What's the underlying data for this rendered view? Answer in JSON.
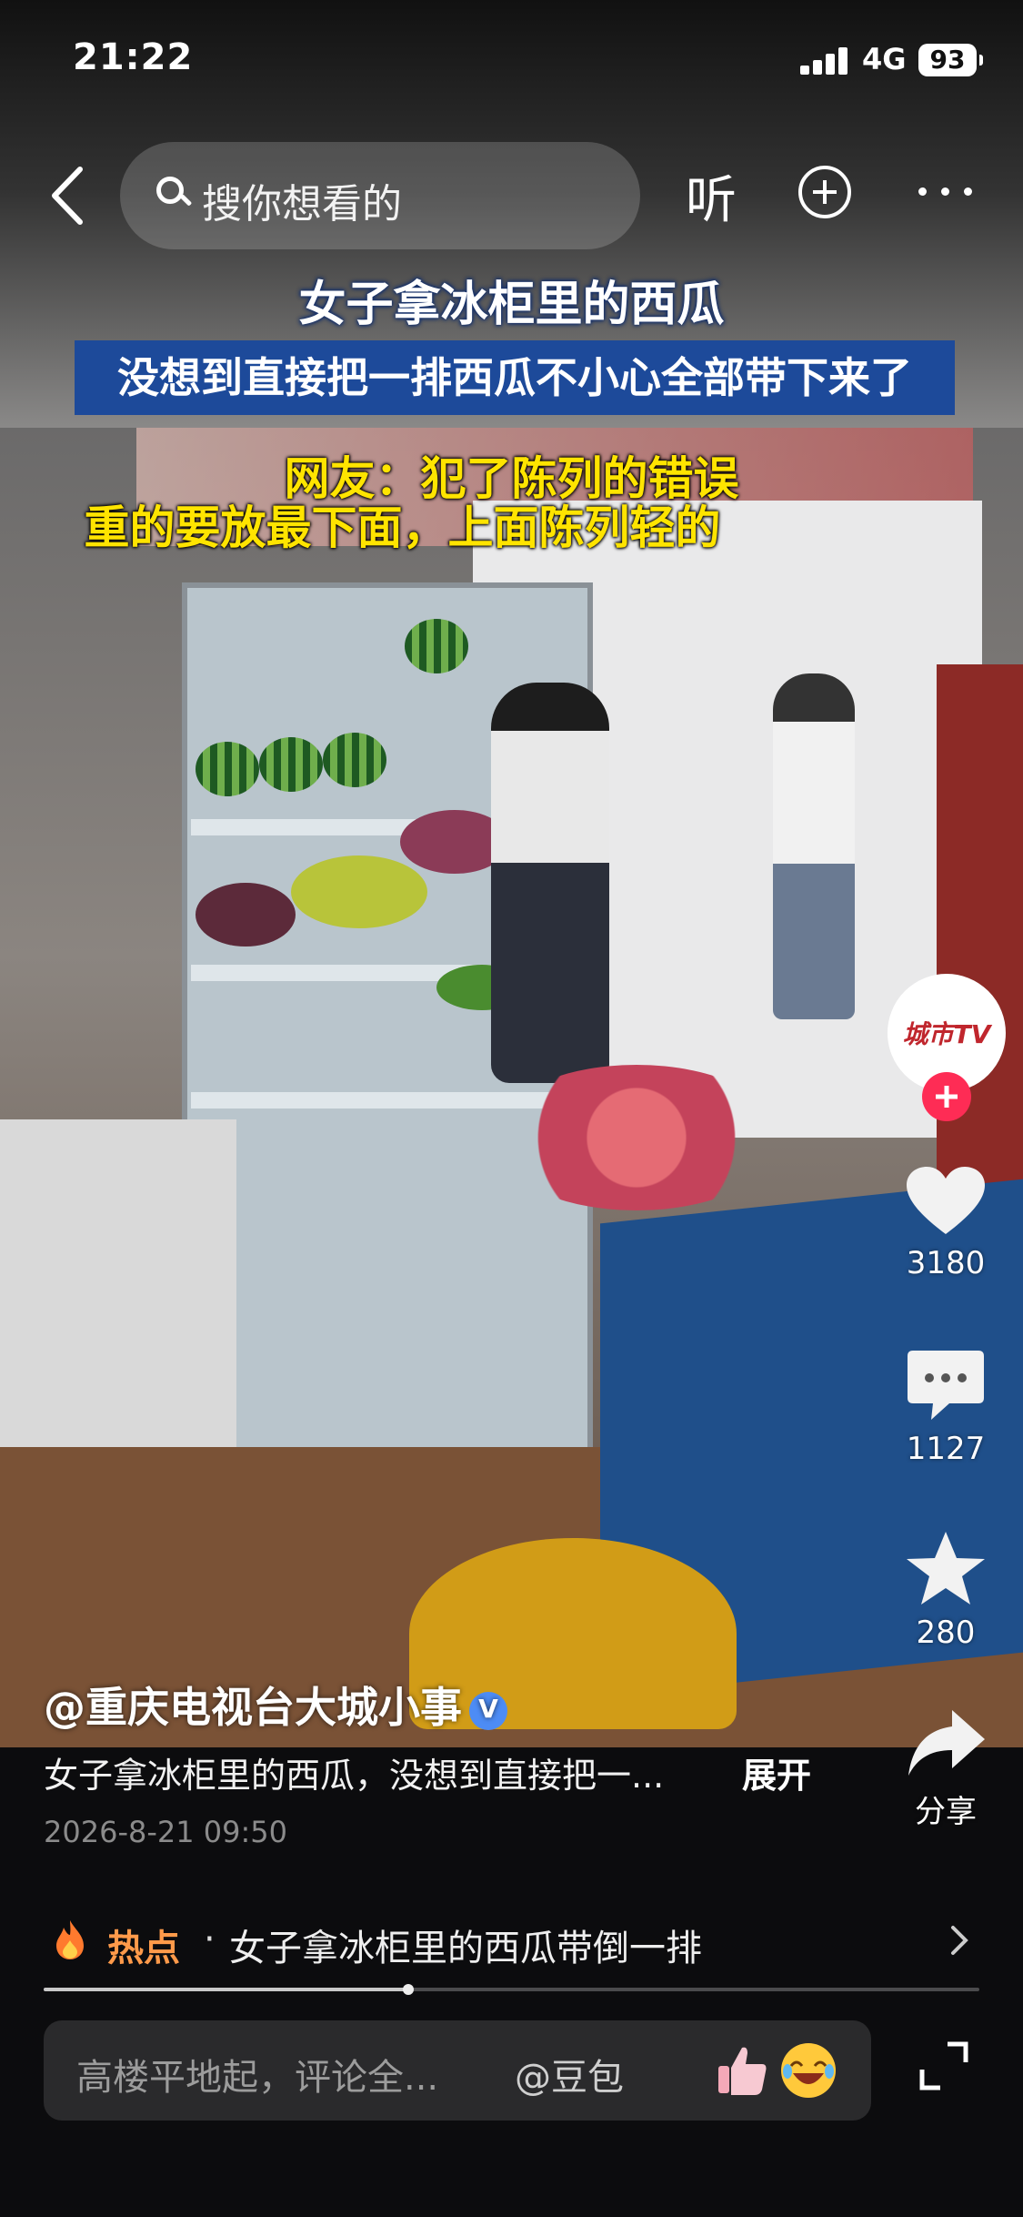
{
  "status_bar": {
    "time": "21:22",
    "network": "4G",
    "battery": "93"
  },
  "header": {
    "search_placeholder": "搜你想看的",
    "listen_label": "听"
  },
  "video": {
    "caption_title": "女子拿冰柜里的西瓜",
    "caption_subtitle": "没想到直接把一排西瓜不小心全部带下来了",
    "overlay_line1": "网友：犯了陈列的错误",
    "overlay_line2": "重的要放最下面，上面陈列轻的",
    "channel_logo_text": "城市TV"
  },
  "actions": {
    "likes": "3180",
    "comments": "1127",
    "favorites": "280",
    "share_label": "分享"
  },
  "post": {
    "author": "@重庆电视台大城小事",
    "description": "女子拿冰柜里的西瓜，没想到直接把一...",
    "expand_label": "展开",
    "date": "2026-8-21 09:50"
  },
  "hot": {
    "label": "热点",
    "separator": "·",
    "text": "女子拿冰柜里的西瓜带倒一排"
  },
  "playback": {
    "progress_fraction": 0.39
  },
  "comment_box": {
    "placeholder": "高楼平地起，评论全...",
    "mention": "@豆包"
  },
  "colors": {
    "accent_red": "#fe2c55",
    "hot_orange": "#ff9a4a",
    "caption_blue": "#1d4a9a",
    "overlay_yellow": "#ffe400"
  }
}
